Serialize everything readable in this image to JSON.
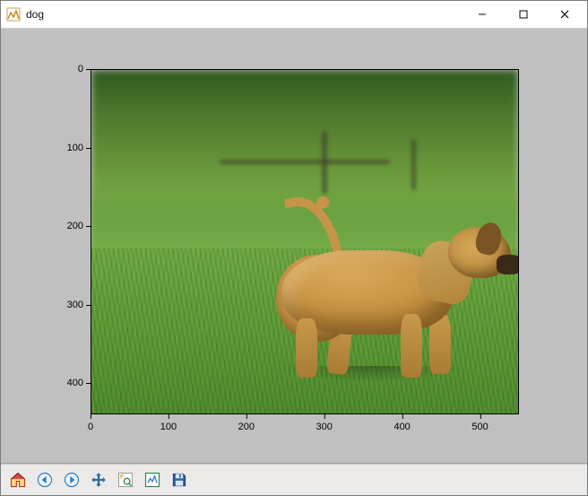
{
  "window": {
    "title": "dog"
  },
  "axes": {
    "x_ticks": [
      "0",
      "100",
      "200",
      "300",
      "400",
      "500"
    ],
    "y_ticks": [
      "0",
      "100",
      "200",
      "300",
      "400"
    ],
    "x_range": [
      0,
      550
    ],
    "y_range": [
      0,
      440
    ],
    "image_width_data": 550,
    "image_height_data": 440
  },
  "toolbar": {
    "buttons": [
      {
        "id": "home",
        "name": "home-icon",
        "tip": "Reset original view"
      },
      {
        "id": "back",
        "name": "back-icon",
        "tip": "Back to previous view"
      },
      {
        "id": "forward",
        "name": "forward-icon",
        "tip": "Forward to next view"
      },
      {
        "id": "pan",
        "name": "pan-icon",
        "tip": "Pan axes"
      },
      {
        "id": "zoom",
        "name": "zoom-icon",
        "tip": "Zoom to rectangle"
      },
      {
        "id": "subplots",
        "name": "subplots-icon",
        "tip": "Configure subplots"
      },
      {
        "id": "save",
        "name": "save-icon",
        "tip": "Save the figure"
      }
    ]
  },
  "image": {
    "subject": "puppy on grass",
    "description": "A tan puppy standing on green grass, facing right, tail curled up, blurred green background with fence posts."
  }
}
